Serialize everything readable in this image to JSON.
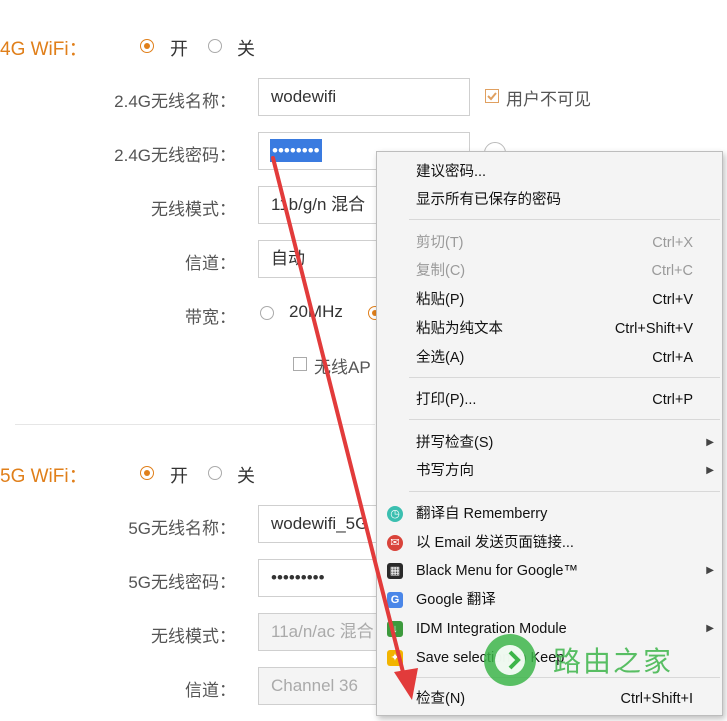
{
  "wifi24": {
    "title": "4G WiFi：",
    "on_label": "开",
    "off_label": "关",
    "name_label": "2.4G无线名称：",
    "name_value": "wodewifi",
    "hidden_label": "用户不可见",
    "password_label": "2.4G无线密码：",
    "password_value": "••••••••",
    "mode_label": "无线模式：",
    "mode_value": "11b/g/n 混合",
    "channel_label": "信道：",
    "channel_value": "自动",
    "bandwidth_label": "带宽：",
    "bw_option1": "20MHz",
    "ap_isolation_label": "无线AP"
  },
  "wifi5": {
    "title": "5G WiFi：",
    "on_label": "开",
    "off_label": "关",
    "name_label": "5G无线名称：",
    "name_value": "wodewifi_5G",
    "password_label": "5G无线密码：",
    "password_value": "•••••••••",
    "mode_label": "无线模式：",
    "mode_value": "11a/n/ac 混合",
    "channel_label": "信道：",
    "channel_value": "Channel 36"
  },
  "context_menu": {
    "suggest_password": "建议密码...",
    "show_saved_passwords": "显示所有已保存的密码",
    "cut": "剪切(T)",
    "cut_shortcut": "Ctrl+X",
    "copy": "复制(C)",
    "copy_shortcut": "Ctrl+C",
    "paste": "粘贴(P)",
    "paste_shortcut": "Ctrl+V",
    "paste_plain": "粘贴为纯文本",
    "paste_plain_shortcut": "Ctrl+Shift+V",
    "select_all": "全选(A)",
    "select_all_shortcut": "Ctrl+A",
    "print": "打印(P)...",
    "print_shortcut": "Ctrl+P",
    "spellcheck": "拼写检查(S)",
    "writing_direction": "书写方向",
    "translate_rememberry": "翻译自 Rememberry",
    "email_page_link": "以 Email 发送页面链接...",
    "black_menu": "Black Menu for Google™",
    "google_translate": "Google 翻译",
    "idm": "IDM Integration Module",
    "save_to_keep": "Save selection to Keep",
    "inspect": "检查(N)",
    "inspect_shortcut": "Ctrl+Shift+I"
  },
  "watermark": {
    "text": "路由之家"
  },
  "colors": {
    "accent_orange": "#e07f1a",
    "selection_blue": "#3a7be0",
    "arrow_red": "#e23b3b",
    "watermark_green": "#3db54a"
  }
}
